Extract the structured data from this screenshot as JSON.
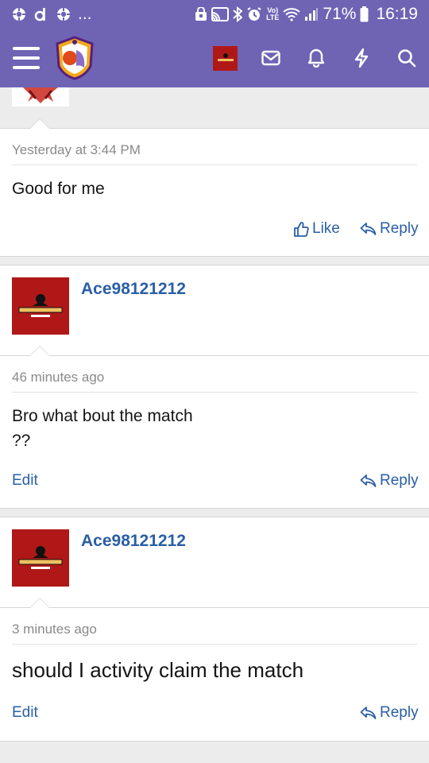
{
  "status_bar": {
    "battery": "71%",
    "time": "16:19",
    "network_top": "Vo)",
    "network_bottom": "LTE",
    "dots": "..."
  },
  "header": {
    "menu_icon": "hamburger-icon",
    "icons": [
      "avatar-thumbnail",
      "mail-icon",
      "bell-icon",
      "bolt-icon",
      "search-icon"
    ]
  },
  "posts": [
    {
      "timestamp": "Yesterday at 3:44 PM",
      "text": "Good for me",
      "actions": {
        "like": "Like",
        "reply": "Reply"
      }
    },
    {
      "username": "Ace98121212",
      "timestamp": "46 minutes ago",
      "text_line1": "Bro what bout the match",
      "text_line2": "??",
      "actions": {
        "edit": "Edit",
        "reply": "Reply"
      }
    },
    {
      "username": "Ace98121212",
      "timestamp": "3 minutes ago",
      "text": "should I activity claim the match",
      "actions": {
        "edit": "Edit",
        "reply": "Reply"
      }
    }
  ],
  "colors": {
    "header_bg": "#6f63b4",
    "link": "#2a5ea6",
    "avatar_red": "#b01818"
  }
}
